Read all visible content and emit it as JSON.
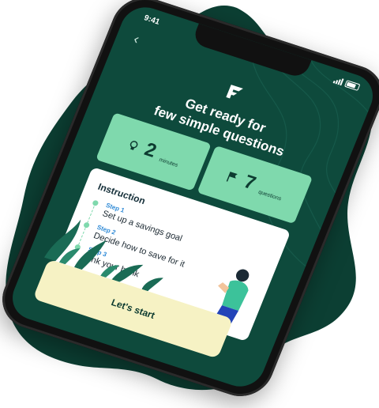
{
  "status": {
    "time": "9:41"
  },
  "header": {
    "back_icon": "chevron-left-icon",
    "logo_icon": "f-logo-icon",
    "title_line1": "Get ready for",
    "title_line2": "few simple questions"
  },
  "stats": [
    {
      "icon": "lightbulb-icon",
      "value": "2",
      "label": "minutes"
    },
    {
      "icon": "flag-icon",
      "value": "7",
      "label": "questions"
    }
  ],
  "instruction": {
    "title": "Instruction",
    "steps": [
      {
        "label": "Step 1",
        "text": "Set up a savings goal"
      },
      {
        "label": "Step 2",
        "text": "Decide how to save for it"
      },
      {
        "label": "Step 3",
        "text": "Link your bank"
      }
    ]
  },
  "cta": {
    "label": "Let's start"
  },
  "colors": {
    "screen_bg": "#0e4a3c",
    "accent_mint": "#7fd9ad",
    "cta_bg": "#f6f2c4",
    "step_blue": "#2f8ad6"
  }
}
